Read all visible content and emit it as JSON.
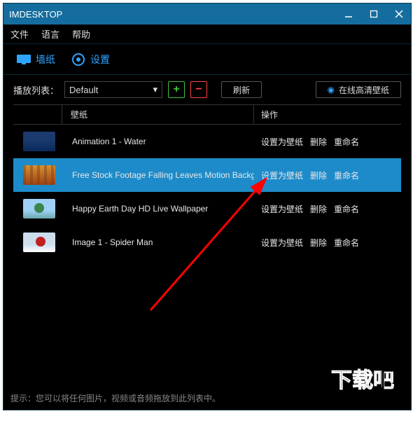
{
  "titlebar": {
    "title": "IMDESKTOP"
  },
  "menu": {
    "file": "文件",
    "language": "语言",
    "help": "帮助"
  },
  "tabs": {
    "wallpaper": "墙纸",
    "settings": "设置"
  },
  "toolbar": {
    "playlist_label": "播放列表：",
    "playlist_value": "Default",
    "refresh": "刷新",
    "online": "在线高清壁纸"
  },
  "headers": {
    "wallpaper": "壁纸",
    "actions": "操作"
  },
  "actions": {
    "set": "设置为壁纸",
    "delete": "删除",
    "rename": "重命名"
  },
  "rows": [
    {
      "name": "Animation 1 - Water",
      "thumb": "th-water",
      "selected": false
    },
    {
      "name": "Free Stock Footage Falling Leaves Motion Backg",
      "thumb": "th-leaves",
      "selected": true
    },
    {
      "name": "Happy Earth Day HD Live Wallpaper",
      "thumb": "th-earth",
      "selected": false
    },
    {
      "name": "Image 1 - Spider Man",
      "thumb": "th-spider",
      "selected": false
    }
  ],
  "hint": "提示：您可以将任何图片，视频或音频拖放到此列表中。",
  "colors": {
    "accent": "#146d9e",
    "link": "#2fa4ff",
    "rowsel": "#1d8bc9"
  }
}
